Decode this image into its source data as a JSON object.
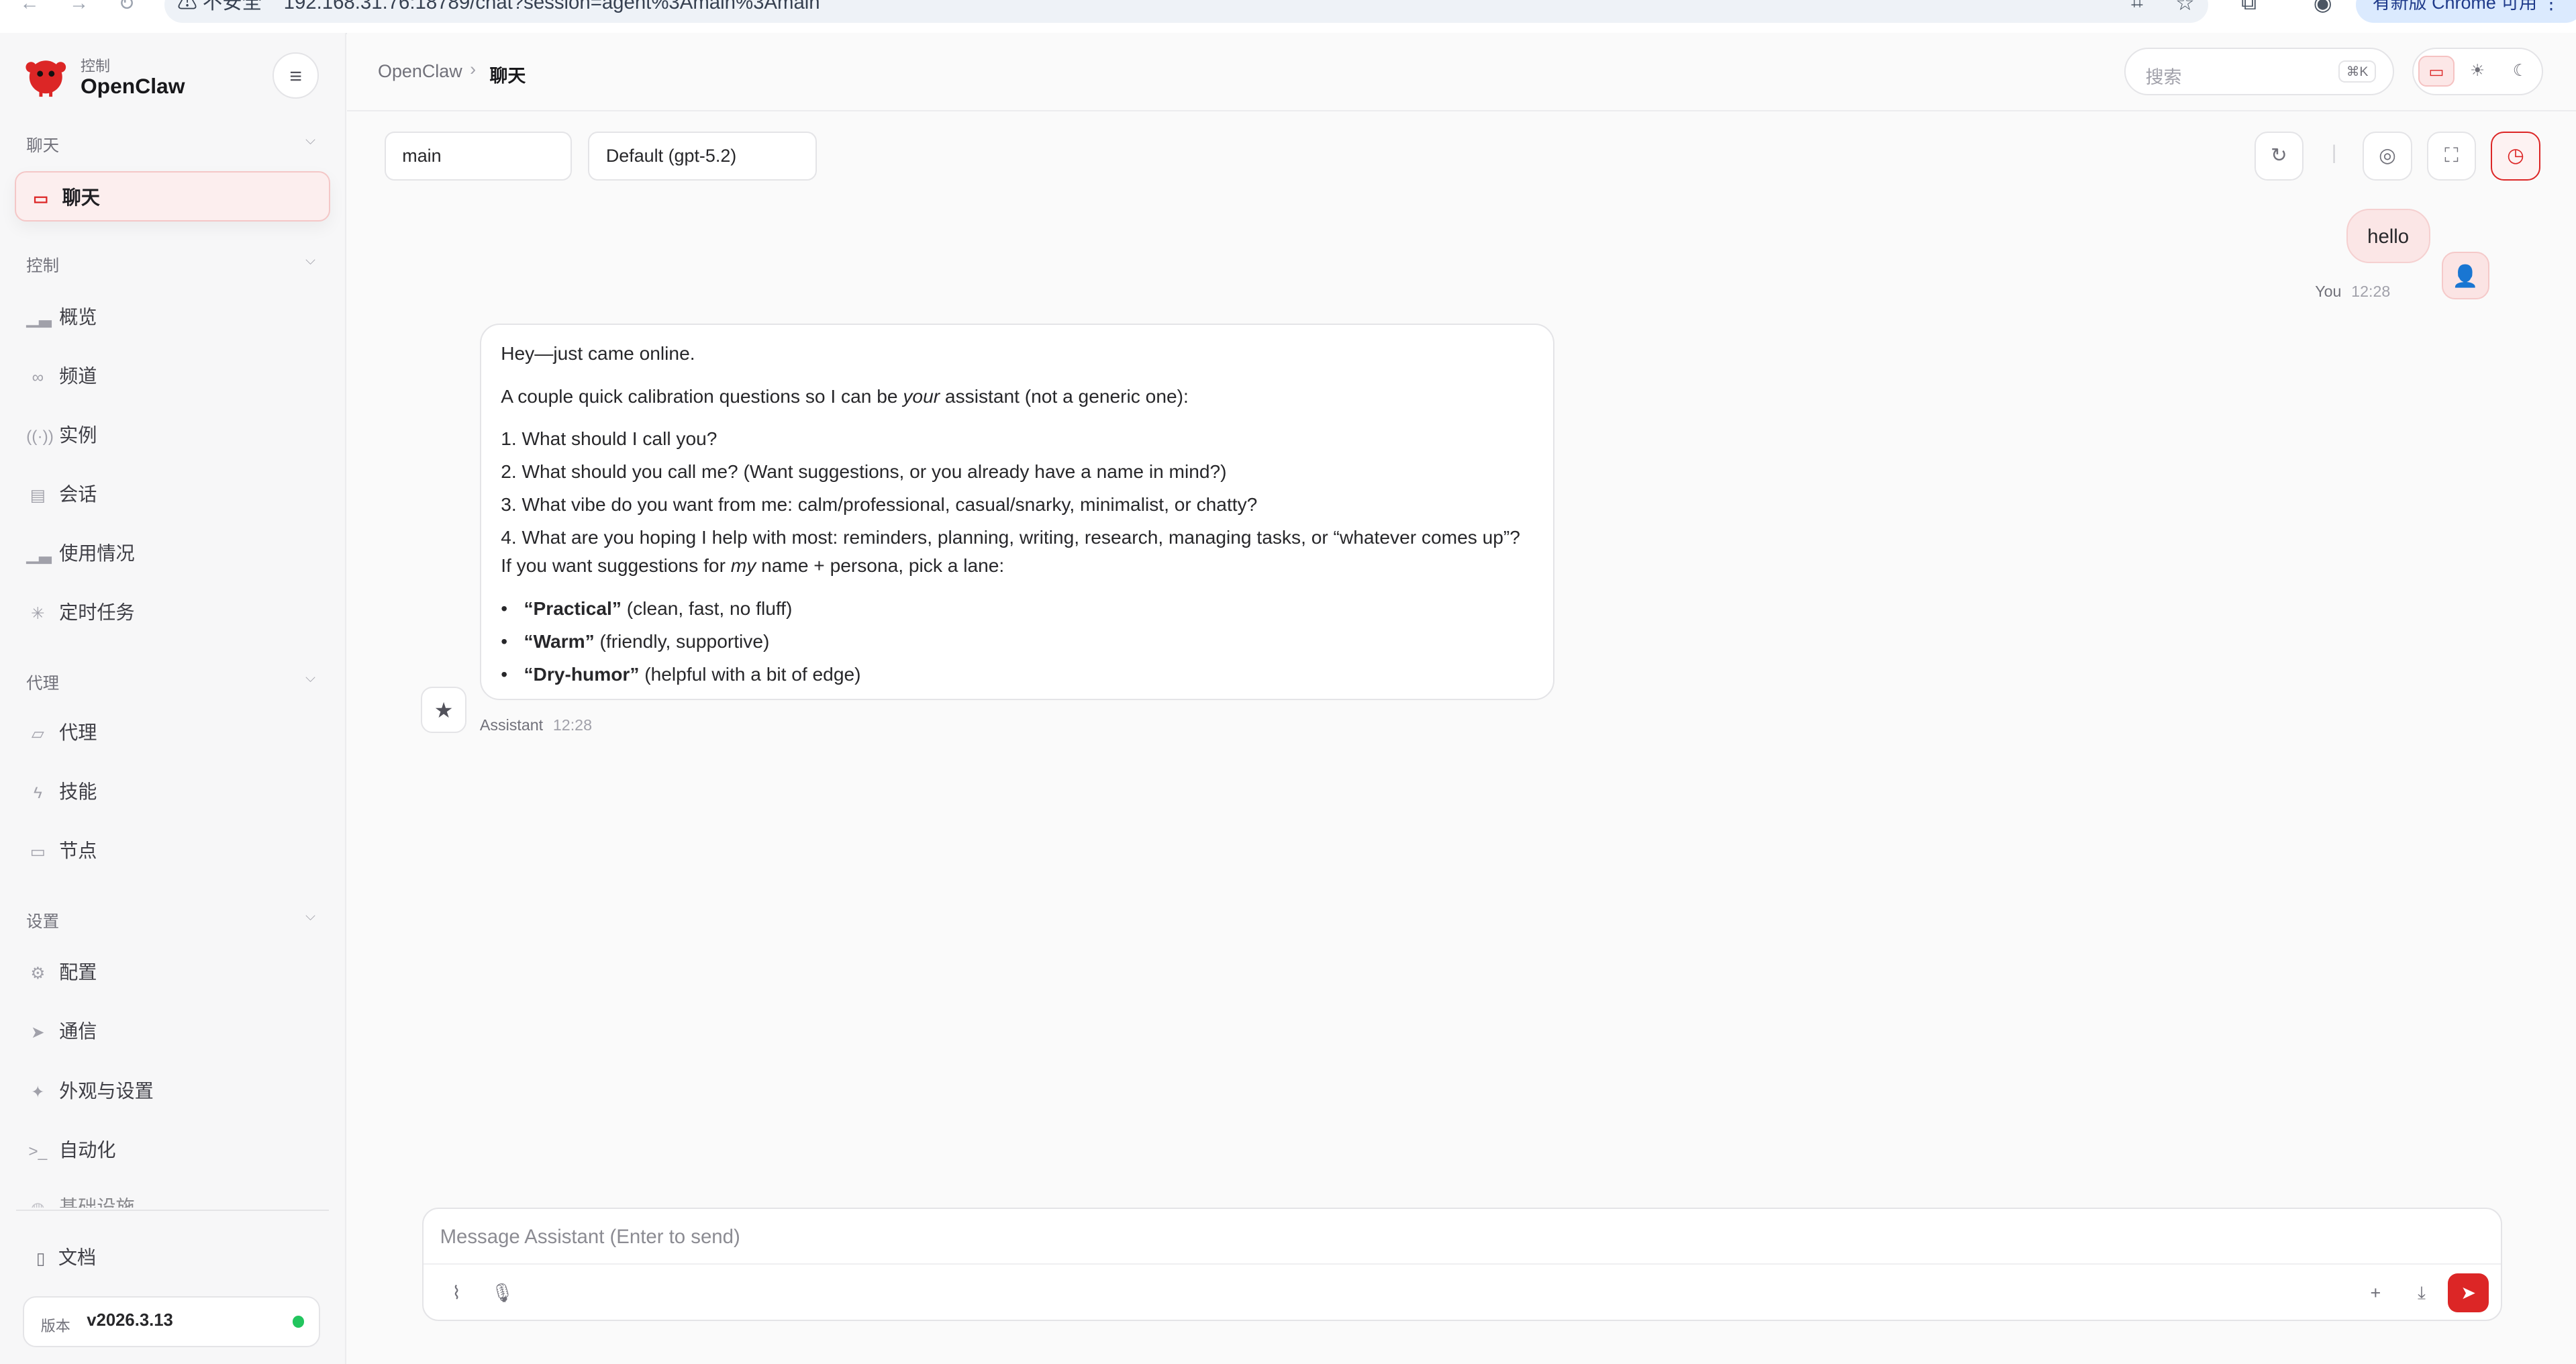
{
  "browser": {
    "security_label": "不安全",
    "url": "192.168.31.76:18789/chat?session=agent%3Amain%3Amain",
    "update_label": "有新版 Chrome 可用"
  },
  "sidebar": {
    "brand_sub": "控制",
    "brand_name": "OpenClaw",
    "sections": [
      {
        "label": "聊天",
        "items": [
          {
            "label": "聊天",
            "icon": "chat-bubble-icon",
            "active": true
          }
        ]
      },
      {
        "label": "控制",
        "items": [
          {
            "label": "概览",
            "icon": "bar-chart-icon"
          },
          {
            "label": "频道",
            "icon": "link-icon"
          },
          {
            "label": "实例",
            "icon": "radio-waves-icon"
          },
          {
            "label": "会话",
            "icon": "document-icon"
          },
          {
            "label": "使用情况",
            "icon": "bar-chart-icon"
          },
          {
            "label": "定时任务",
            "icon": "loader-icon"
          }
        ]
      },
      {
        "label": "代理",
        "items": [
          {
            "label": "代理",
            "icon": "folder-icon"
          },
          {
            "label": "技能",
            "icon": "lightning-icon"
          },
          {
            "label": "节点",
            "icon": "monitor-icon"
          }
        ]
      },
      {
        "label": "设置",
        "items": [
          {
            "label": "配置",
            "icon": "gear-icon"
          },
          {
            "label": "通信",
            "icon": "send-icon"
          },
          {
            "label": "外观与设置",
            "icon": "sparkle-icon"
          },
          {
            "label": "自动化",
            "icon": "terminal-icon"
          },
          {
            "label": "基础设施",
            "icon": "globe-icon"
          }
        ]
      }
    ],
    "docs_label": "文档",
    "version_label": "版本",
    "version_value": "v2026.3.13",
    "status_color": "#22c55e"
  },
  "topbar": {
    "breadcrumb_root": "OpenClaw",
    "breadcrumb_sep": "›",
    "breadcrumb_current": "聊天",
    "search_placeholder": "搜索",
    "search_shortcut": "⌘K",
    "theme_modes": [
      "monitor-icon",
      "sun-icon",
      "moon-icon"
    ],
    "theme_active": "monitor-icon"
  },
  "controls": {
    "session_value": "main",
    "model_value": "Default (gpt-5.2)",
    "buttons": [
      "refresh-icon",
      "brain-icon",
      "focus-icon",
      "clock-icon"
    ]
  },
  "messages": {
    "user": {
      "text": "hello",
      "sender": "You",
      "time": "12:28"
    },
    "assistant": {
      "sender": "Assistant",
      "time": "12:28",
      "greeting": "Hey—just came online.",
      "intro_pre": "A couple quick calibration questions so I can be ",
      "intro_em": "your",
      "intro_post": " assistant (not a generic one):",
      "questions": [
        "1. What should I call you?",
        "2. What should you call me? (Want suggestions, or you already have a name in mind?)",
        "3. What vibe do you want from me: calm/professional, casual/snarky, minimalist, or chatty?",
        "4. What are you hoping I help with most: reminders, planning, writing, research, managing tasks, or “whatever comes up”?"
      ],
      "suggest_pre": "If you want suggestions for ",
      "suggest_em": "my",
      "suggest_post": " name + persona, pick a lane:",
      "lanes": [
        {
          "name": "“Practical”",
          "desc": " (clean, fast, no fluff)"
        },
        {
          "name": "“Warm”",
          "desc": " (friendly, supportive)"
        },
        {
          "name": "“Dry-humor”",
          "desc": " (helpful with a bit of edge)"
        }
      ]
    }
  },
  "composer": {
    "placeholder": "Message Assistant (Enter to send)",
    "value": ""
  },
  "colors": {
    "accent": "#dc2626",
    "accent_soft": "#fceeee",
    "sidebar_bg": "#f7f7f8",
    "page_bg": "#fafafa"
  }
}
